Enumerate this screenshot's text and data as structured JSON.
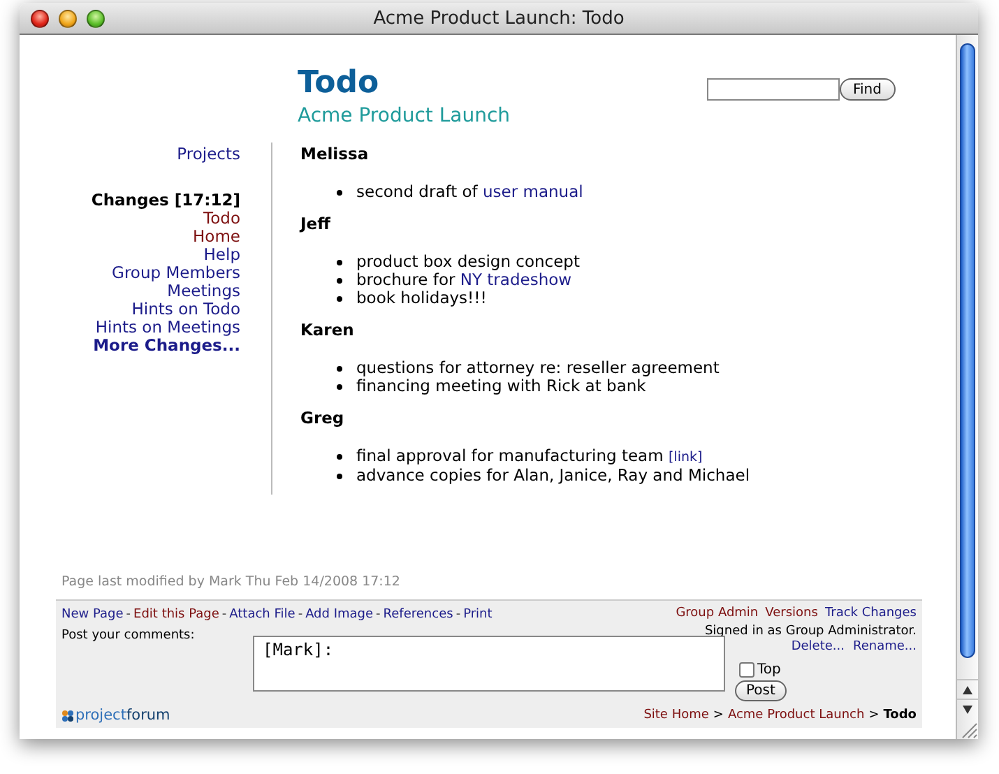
{
  "window": {
    "title": "Acme Product Launch: Todo"
  },
  "header": {
    "title": "Todo",
    "subtitle": "Acme Product Launch"
  },
  "search": {
    "button": "Find"
  },
  "sidebar": {
    "top_link": "Projects",
    "changes_heading": "Changes [17:12]",
    "links": [
      {
        "label": "Todo",
        "visited": true
      },
      {
        "label": "Home",
        "visited": true
      },
      {
        "label": "Help",
        "visited": false
      },
      {
        "label": "Group Members",
        "visited": false
      },
      {
        "label": "Meetings",
        "visited": false
      },
      {
        "label": "Hints on Todo",
        "visited": false
      },
      {
        "label": "Hints on Meetings",
        "visited": false
      }
    ],
    "more": "More Changes..."
  },
  "sections": [
    {
      "name": "Melissa",
      "items": [
        {
          "parts": [
            {
              "text": "second draft of ",
              "kind": "text"
            },
            {
              "text": "user manual",
              "kind": "link"
            }
          ]
        }
      ]
    },
    {
      "name": "Jeff",
      "items": [
        {
          "parts": [
            {
              "text": "product box design concept",
              "kind": "text"
            }
          ]
        },
        {
          "parts": [
            {
              "text": "brochure for ",
              "kind": "text"
            },
            {
              "text": "NY tradeshow",
              "kind": "link"
            }
          ]
        },
        {
          "parts": [
            {
              "text": "book holidays!!!",
              "kind": "text"
            }
          ]
        }
      ]
    },
    {
      "name": "Karen",
      "items": [
        {
          "parts": [
            {
              "text": "questions for attorney re: reseller agreement",
              "kind": "text"
            }
          ]
        },
        {
          "parts": [
            {
              "text": "financing meeting with Rick at bank",
              "kind": "text"
            }
          ]
        }
      ]
    },
    {
      "name": "Greg",
      "items": [
        {
          "parts": [
            {
              "text": "final approval for manufacturing team ",
              "kind": "text"
            },
            {
              "text": "[link]",
              "kind": "small-link"
            }
          ]
        },
        {
          "parts": [
            {
              "text": "advance copies for Alan, Janice, Ray and Michael",
              "kind": "text"
            }
          ]
        }
      ]
    }
  ],
  "footer": {
    "modified": "Page last modified by Mark Thu Feb 14/2008 17:12",
    "separator": "-",
    "actions": [
      {
        "label": "New Page",
        "visited": false
      },
      {
        "label": "Edit this Page",
        "visited": true
      },
      {
        "label": "Attach File",
        "visited": false
      },
      {
        "label": "Add Image",
        "visited": false
      },
      {
        "label": "References",
        "visited": false
      },
      {
        "label": "Print",
        "visited": false
      }
    ],
    "admin_links": [
      {
        "label": "Group Admin",
        "visited": true
      },
      {
        "label": "Versions",
        "visited": true
      },
      {
        "label": "Track Changes",
        "visited": false
      }
    ],
    "signed_in": "Signed in as Group Administrator.",
    "page_links": [
      {
        "label": "Delete...",
        "visited": false
      },
      {
        "label": "Rename...",
        "visited": false
      }
    ],
    "comment_label": "Post your comments:",
    "comment_value": "[Mark]:",
    "top_checkbox": {
      "label": "Top",
      "checked": false
    },
    "post_button": "Post",
    "logo": [
      "project",
      "forum"
    ],
    "breadcrumb_separator": ">",
    "breadcrumb": [
      {
        "label": "Site Home",
        "current": false
      },
      {
        "label": "Acme Product Launch",
        "current": false
      },
      {
        "label": "Todo",
        "current": true
      }
    ]
  }
}
